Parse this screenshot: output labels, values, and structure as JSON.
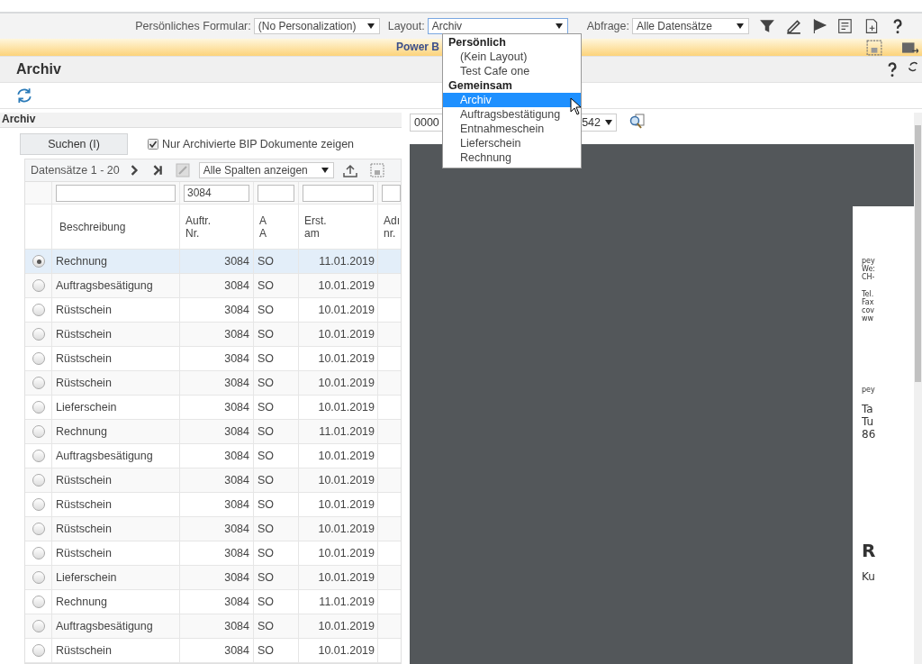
{
  "top_bar": {
    "form_label": "Persönliches Formular:",
    "form_value": "(No Personalization)",
    "layout_label": "Layout:",
    "layout_value": "Archiv",
    "query_label": "Abfrage:",
    "query_value": "Alle Datensätze"
  },
  "banner": {
    "title": "Power B"
  },
  "page": {
    "title": "Archiv"
  },
  "panel": {
    "title": "Archiv",
    "search_button": "Suchen (I)",
    "archived_only": {
      "label": "Nur Archivierte BIP Dokumente zeigen",
      "checked": true
    }
  },
  "grid_toolbar": {
    "records": "Datensätze 1 - 20",
    "columns_select": "Alle Spalten anzeigen"
  },
  "table": {
    "order_number_filter": "3084",
    "columns": [
      "Beschreibung",
      "Auftr.\nNr.",
      "A\nA",
      "Erst.\nam",
      "Adı\nnr."
    ],
    "rows": [
      {
        "selected": true,
        "cells": [
          "Rechnung",
          "3084",
          "SO",
          "11.01.2019"
        ]
      },
      {
        "selected": false,
        "cells": [
          "Auftragsbesätigung",
          "3084",
          "SO",
          "10.01.2019"
        ]
      },
      {
        "selected": false,
        "cells": [
          "Rüstschein",
          "3084",
          "SO",
          "10.01.2019"
        ]
      },
      {
        "selected": false,
        "cells": [
          "Rüstschein",
          "3084",
          "SO",
          "10.01.2019"
        ]
      },
      {
        "selected": false,
        "cells": [
          "Rüstschein",
          "3084",
          "SO",
          "10.01.2019"
        ]
      },
      {
        "selected": false,
        "cells": [
          "Rüstschein",
          "3084",
          "SO",
          "10.01.2019"
        ]
      },
      {
        "selected": false,
        "cells": [
          "Lieferschein",
          "3084",
          "SO",
          "10.01.2019"
        ]
      },
      {
        "selected": false,
        "cells": [
          "Rechnung",
          "3084",
          "SO",
          "11.01.2019"
        ]
      },
      {
        "selected": false,
        "cells": [
          "Auftragsbesätigung",
          "3084",
          "SO",
          "10.01.2019"
        ]
      },
      {
        "selected": false,
        "cells": [
          "Rüstschein",
          "3084",
          "SO",
          "10.01.2019"
        ]
      },
      {
        "selected": false,
        "cells": [
          "Rüstschein",
          "3084",
          "SO",
          "10.01.2019"
        ]
      },
      {
        "selected": false,
        "cells": [
          "Rüstschein",
          "3084",
          "SO",
          "10.01.2019"
        ]
      },
      {
        "selected": false,
        "cells": [
          "Rüstschein",
          "3084",
          "SO",
          "10.01.2019"
        ]
      },
      {
        "selected": false,
        "cells": [
          "Lieferschein",
          "3084",
          "SO",
          "10.01.2019"
        ]
      },
      {
        "selected": false,
        "cells": [
          "Rechnung",
          "3084",
          "SO",
          "11.01.2019"
        ]
      },
      {
        "selected": false,
        "cells": [
          "Auftragsbesätigung",
          "3084",
          "SO",
          "10.01.2019"
        ]
      },
      {
        "selected": false,
        "cells": [
          "Rüstschein",
          "3084",
          "SO",
          "10.01.2019"
        ]
      }
    ]
  },
  "viewer": {
    "document_select_start": "0000",
    "document_select_end": "542",
    "document_lines": [
      {
        "kind": "small",
        "text": "pey"
      },
      {
        "kind": "small",
        "text": "We:"
      },
      {
        "kind": "small",
        "text": "CH-"
      },
      {
        "kind": "gap"
      },
      {
        "kind": "small",
        "text": "Tel."
      },
      {
        "kind": "small",
        "text": "Fax"
      },
      {
        "kind": "small",
        "text": "cov"
      },
      {
        "kind": "small",
        "text": "ww"
      },
      {
        "kind": "bigGap"
      },
      {
        "kind": "small",
        "text": "pey"
      },
      {
        "kind": "gap"
      },
      {
        "kind": "medium",
        "text": "Ta"
      },
      {
        "kind": "medium",
        "text": "Tu"
      },
      {
        "kind": "medium",
        "text": "86"
      },
      {
        "kind": "hugeGap"
      },
      {
        "kind": "heading",
        "text": "R"
      },
      {
        "kind": "gap"
      },
      {
        "kind": "medium",
        "text": "Ku"
      }
    ]
  },
  "layout_menu": [
    {
      "kind": "group",
      "label": "Persönlich",
      "selected": false
    },
    {
      "kind": "option",
      "label": "(Kein Layout)",
      "selected": false
    },
    {
      "kind": "option",
      "label": "Test Cafe one",
      "selected": false
    },
    {
      "kind": "group",
      "label": "Gemeinsam",
      "selected": false
    },
    {
      "kind": "option",
      "label": "Archiv",
      "selected": true
    },
    {
      "kind": "option",
      "label": "Auftragsbestätigung",
      "selected": false
    },
    {
      "kind": "option",
      "label": "Entnahmeschein",
      "selected": false
    },
    {
      "kind": "option",
      "label": "Lieferschein",
      "selected": false
    },
    {
      "kind": "option",
      "label": "Rechnung",
      "selected": false
    }
  ]
}
